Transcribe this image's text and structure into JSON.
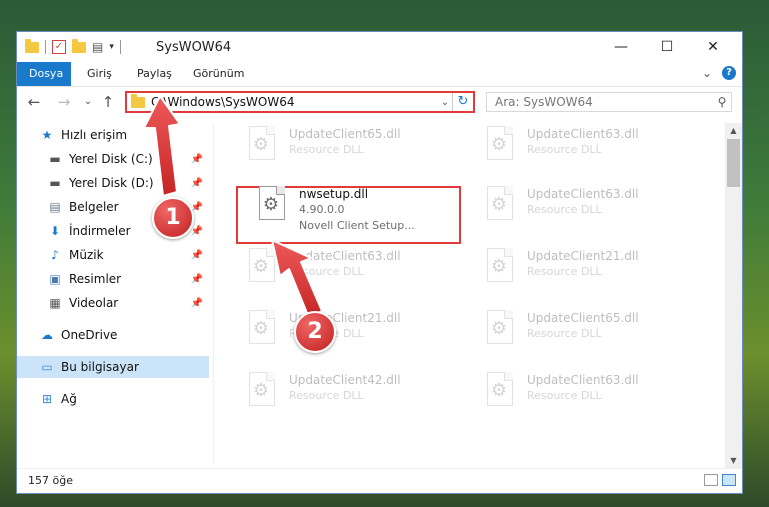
{
  "window": {
    "title": "SysWOW64"
  },
  "title_buttons": {
    "minimize": "—",
    "maximize": "☐",
    "close": "✕"
  },
  "ribbon": {
    "tabs": [
      "Dosya",
      "Giriş",
      "Paylaş",
      "Görünüm"
    ],
    "help": "?",
    "expand": "⌄"
  },
  "nav": {
    "back": "←",
    "forward": "→",
    "recent": "⌄",
    "up": "↑",
    "address": "C:\\Windows\\SysWOW64",
    "address_chevron": "⌄",
    "refresh": "↻",
    "search_placeholder": "Ara: SysWOW64",
    "search_icon": "⚲"
  },
  "sidebar": {
    "quick_access": "Hızlı erişim",
    "items": [
      {
        "label": "Yerel Disk (C:)",
        "icon": "drive-icon",
        "pinned": true
      },
      {
        "label": "Yerel Disk (D:)",
        "icon": "drive-icon",
        "pinned": true
      },
      {
        "label": "Belgeler",
        "icon": "documents-icon",
        "pinned": true
      },
      {
        "label": "İndirmeler",
        "icon": "downloads-icon",
        "pinned": true
      },
      {
        "label": "Müzik",
        "icon": "music-icon",
        "pinned": true
      },
      {
        "label": "Resimler",
        "icon": "pictures-icon",
        "pinned": true
      },
      {
        "label": "Videolar",
        "icon": "videos-icon",
        "pinned": true
      }
    ],
    "onedrive": "OneDrive",
    "this_pc": "Bu bilgisayar",
    "network": "Ağ"
  },
  "files": [
    {
      "name": "UpdateClient65.dll",
      "sub": "Resource DLL",
      "faded": true
    },
    {
      "name": "UpdateClient63.dll",
      "sub": "Resource DLL",
      "faded": true
    },
    {
      "name": "nwsetup.dll",
      "sub": "4.90.0.0",
      "sub2": "Novell Client Setup...",
      "faded": false
    },
    {
      "name": "UpdateClient63.dll",
      "sub": "Resource DLL",
      "faded": true
    },
    {
      "name": "UpdateClient63.dll",
      "sub": "Resource DLL",
      "faded": true
    },
    {
      "name": "UpdateClient21.dll",
      "sub": "Resource DLL",
      "faded": true
    },
    {
      "name": "UpdateClient21.dll",
      "sub": "Resource DLL",
      "faded": true
    },
    {
      "name": "UpdateClient65.dll",
      "sub": "Resource DLL",
      "faded": true
    },
    {
      "name": "UpdateClient42.dll",
      "sub": "Resource DLL",
      "faded": true
    },
    {
      "name": "UpdateClient63.dll",
      "sub": "Resource DLL",
      "faded": true
    }
  ],
  "status": {
    "count": "157 öğe"
  },
  "callouts": [
    "1",
    "2"
  ],
  "colors": {
    "accent": "#1979ca",
    "highlight": "#e03a3a",
    "selected": "#cce4f7"
  }
}
